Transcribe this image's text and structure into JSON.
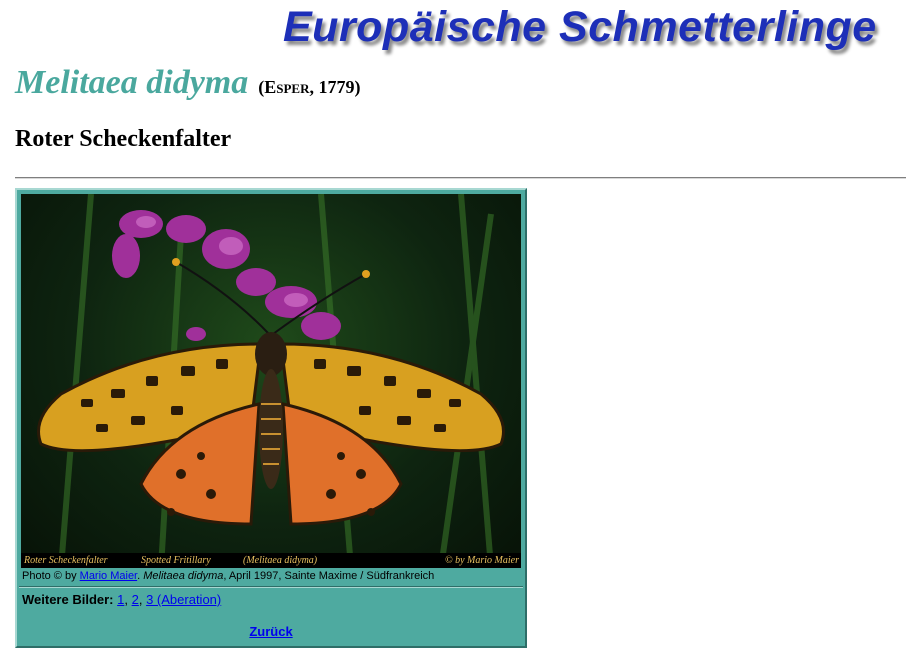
{
  "header": {
    "site_title": "Europäische Schmetterlinge"
  },
  "species": {
    "scientific_name": "Melitaea didyma",
    "author_open": "(",
    "author_name": "Esper",
    "author_year": ", 1779)",
    "common_name": "Roter Scheckenfalter"
  },
  "photo": {
    "strip": {
      "german": "Roter Scheckenfalter",
      "english": "Spotted Fritillary",
      "latin": "(Melitaea didyma)",
      "copyright": "© by Mario Maier"
    },
    "caption": {
      "prefix": "Photo © by",
      "author_link": "Mario Maier",
      "species": "Melitaea didyma",
      "details": ", April 1997, Sainte Maxime / Südfrankreich"
    }
  },
  "more_images": {
    "label": "Weitere Bilder:",
    "links": [
      "1",
      "2",
      "3 (Aberation)"
    ]
  },
  "navigation": {
    "back_label": "Zurück"
  },
  "colors": {
    "site_title": "#1d2fb8",
    "species_name": "#4aa89e",
    "frame": "#4eaaa0",
    "link": "#0000ee"
  }
}
